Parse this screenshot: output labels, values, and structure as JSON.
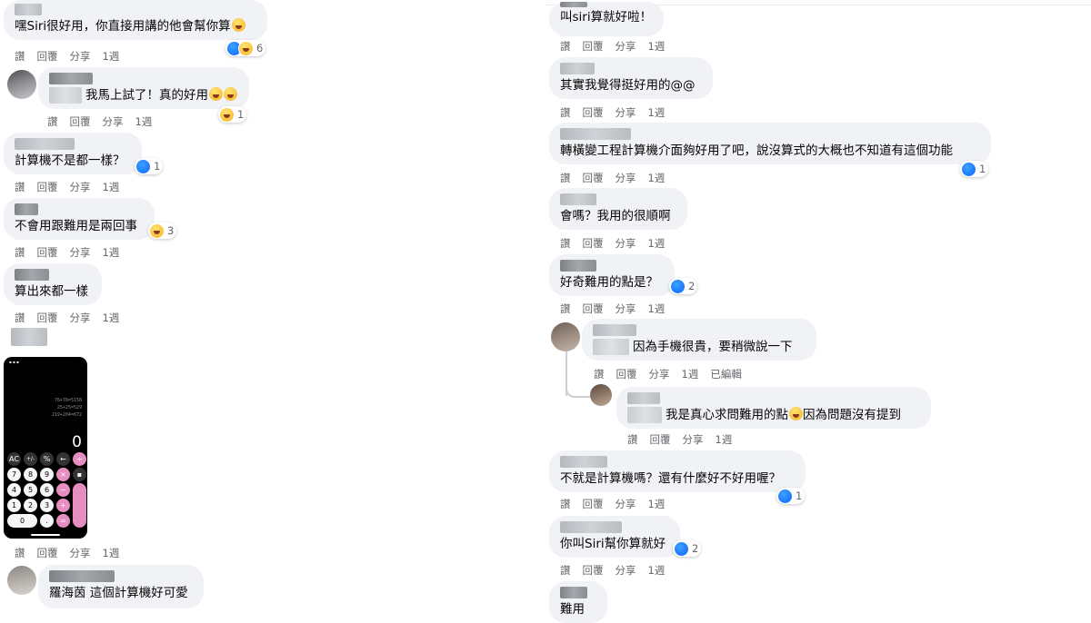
{
  "actions": {
    "like": "讚",
    "reply": "回覆",
    "share": "分享",
    "edited": "已編輯"
  },
  "left": {
    "c1": {
      "text": "嘿Siri很好用，你直接用講的他會幫你算",
      "time": "1週",
      "reactions": "6"
    },
    "c2": {
      "text": "我馬上試了！真的好用",
      "time": "1週",
      "reactions": "1"
    },
    "c3": {
      "text": "計算機不是都一樣？",
      "time": "1週",
      "reactions": "1"
    },
    "c4": {
      "text": "不會用跟難用是兩回事",
      "time": "1週",
      "reactions": "3"
    },
    "c5": {
      "text": "算出來都一樣",
      "time": "1週"
    },
    "c6": {
      "time": "1週"
    },
    "c7": {
      "text": "羅海茵 這個計算機好可愛"
    }
  },
  "phone": {
    "history": [
      "78+78=5158",
      "25+25=529",
      "219+204=672"
    ],
    "display": "0",
    "keys": [
      "AC",
      "+/-",
      "%",
      "←",
      "÷",
      "7",
      "8",
      "9",
      "×",
      "1",
      "4",
      "5",
      "6",
      "−",
      "1",
      "2",
      "3",
      "+",
      "0",
      ".",
      "="
    ]
  },
  "right": {
    "r1": {
      "text": "叫siri算就好啦！",
      "time": "1週"
    },
    "r2": {
      "text": "其實我覺得挺好用的@@",
      "time": "1週"
    },
    "r3": {
      "text": "轉橫變工程計算機介面夠好用了吧，說沒算式的大概也不知道有這個功能",
      "time": "1週",
      "reactions": "1"
    },
    "r4": {
      "text": "會嗎？我用的很順啊",
      "time": "1週"
    },
    "r5": {
      "text": "好奇難用的點是？",
      "time": "1週",
      "reactions": "2"
    },
    "r6": {
      "text": "因為手機很貴，要稍微說一下",
      "time": "1週"
    },
    "r7": {
      "text": "我是真心求問難用的點",
      "text2": "因為問題沒有提到",
      "time": "1週"
    },
    "r8": {
      "text": "不就是計算機嗎？還有什麼好不好用喔？",
      "time": "1週",
      "reactions": "1"
    },
    "r9": {
      "text": "你叫Siri幫你算就好",
      "time": "1週",
      "reactions": "2"
    },
    "r10": {
      "text": "難用"
    }
  }
}
